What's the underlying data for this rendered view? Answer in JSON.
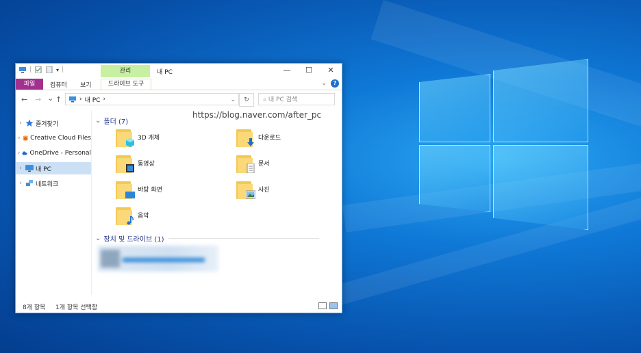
{
  "window": {
    "title": "내 PC",
    "manage_tab": "관리",
    "controls": {
      "minimize": "—",
      "maximize": "☐",
      "close": "✕"
    }
  },
  "ribbon": {
    "file_tab": "파일",
    "tabs": [
      "컴퓨터",
      "보기"
    ],
    "drive_tools_tab": "드라이브 도구",
    "help": "?"
  },
  "address": {
    "back": "←",
    "forward": "→",
    "recent": "⌄",
    "up": "↑",
    "path_separator_1": "›",
    "path_label": "내 PC",
    "path_separator_2": "›",
    "dropdown": "⌄",
    "refresh": "↻",
    "search_placeholder": "⌕  내 PC 검색"
  },
  "sidebar": {
    "items": [
      {
        "label": "즐겨찾기",
        "icon": "star-icon",
        "color": "#2b7bd6"
      },
      {
        "label": "Creative Cloud Files",
        "icon": "creative-cloud-icon",
        "color": "#e8542a"
      },
      {
        "label": "OneDrive - Personal",
        "icon": "onedrive-icon",
        "color": "#1f6ed4"
      },
      {
        "label": "내 PC",
        "icon": "pc-icon",
        "color": "#3b8fe0",
        "selected": true
      },
      {
        "label": "네트워크",
        "icon": "network-icon",
        "color": "#3b8fe0"
      }
    ]
  },
  "watermark": "https://blog.naver.com/after_pc",
  "folders_group": {
    "header": "폴더 (7)",
    "items": [
      {
        "label": "3D 개체",
        "icon": "3d-objects-icon"
      },
      {
        "label": "다운로드",
        "icon": "downloads-icon"
      },
      {
        "label": "동영상",
        "icon": "videos-icon"
      },
      {
        "label": "문서",
        "icon": "documents-icon"
      },
      {
        "label": "바탕 화면",
        "icon": "desktop-icon"
      },
      {
        "label": "사진",
        "icon": "pictures-icon"
      },
      {
        "label": "음악",
        "icon": "music-icon"
      }
    ]
  },
  "devices_group": {
    "header": "장치 및 드라이브 (1)"
  },
  "status": {
    "item_count": "8개 항목",
    "selected": "1개 항목 선택함"
  }
}
